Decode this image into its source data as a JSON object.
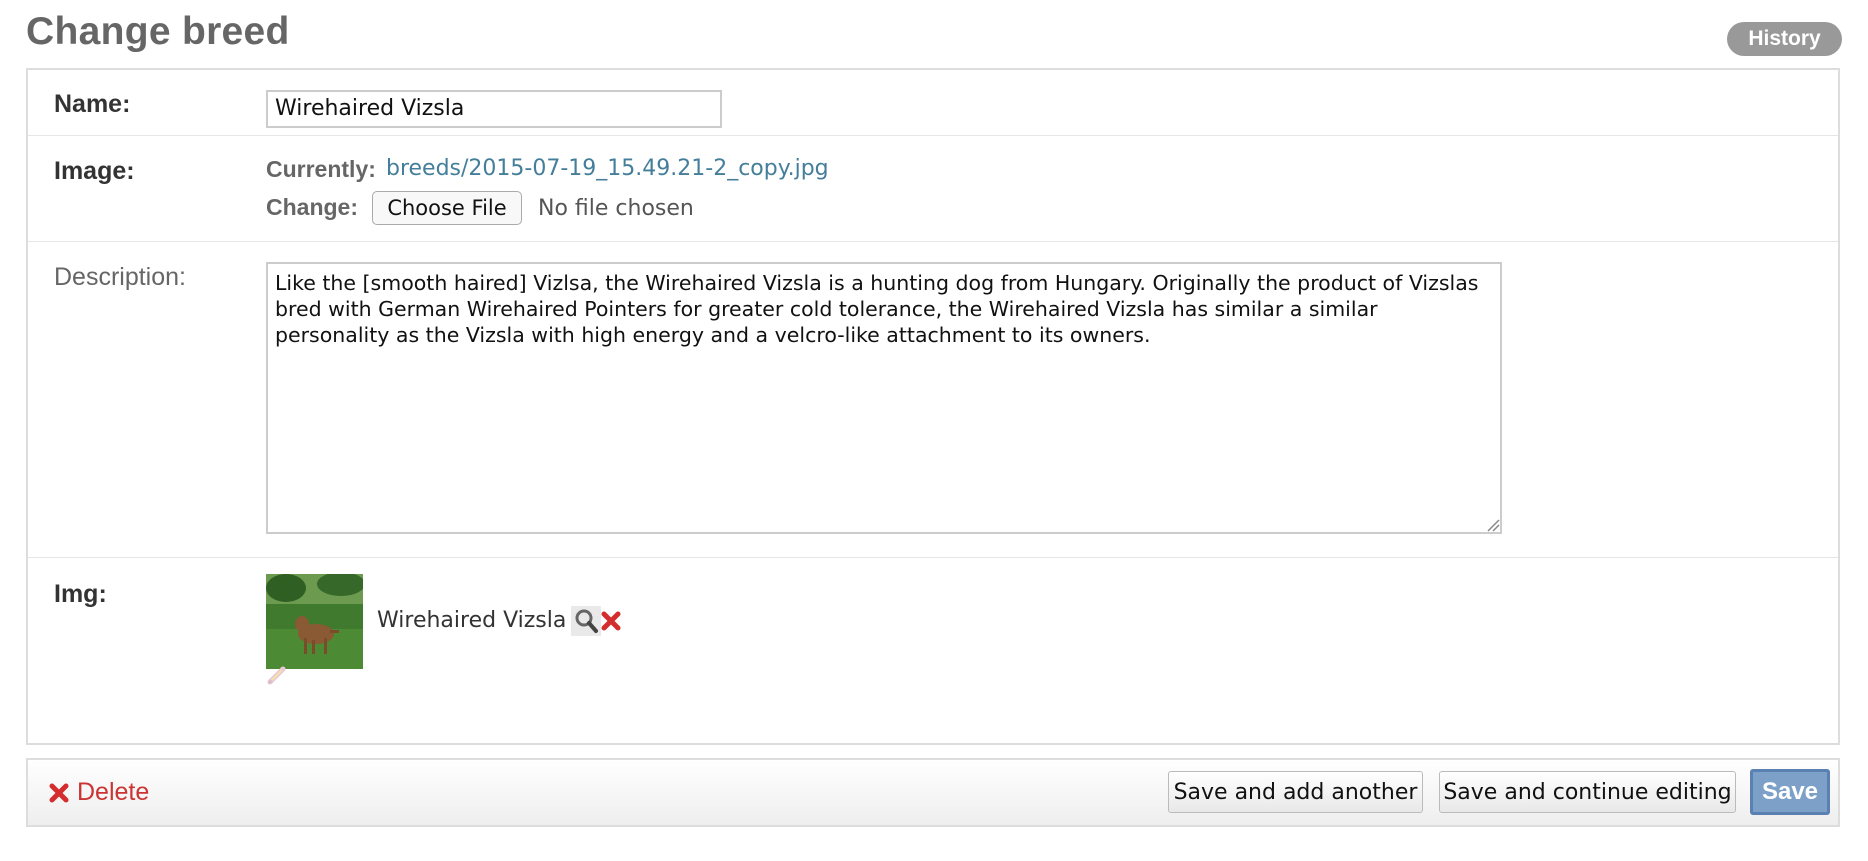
{
  "header": {
    "title": "Change breed",
    "history_label": "History"
  },
  "form": {
    "name": {
      "label": "Name:",
      "value": "Wirehaired Vizsla"
    },
    "image": {
      "label": "Image:",
      "currently_label": "Currently:",
      "current_file": "breeds/2015-07-19_15.49.21-2_copy.jpg",
      "change_label": "Change:",
      "choose_file_label": "Choose File",
      "no_file_text": "No file chosen"
    },
    "description": {
      "label": "Description:",
      "value": "Like the [smooth haired] Vizlsa, the Wirehaired Vizsla is a hunting dog from Hungary. Originally the product of Vizslas bred with German Wirehaired Pointers for greater cold tolerance, the Wirehaired Vizsla has similar a similar personality as the Vizsla with high energy and a velcro-like attachment to its owners."
    },
    "img": {
      "label": "Img:",
      "selected_name": "Wirehaired Vizsla",
      "lookup_icon": "magnifier-icon",
      "remove_icon": "red-x-icon",
      "edit_icon": "pencil-icon"
    }
  },
  "submit_row": {
    "delete_label": "Delete",
    "save_add_label": "Save and add another",
    "save_continue_label": "Save and continue editing",
    "save_label": "Save"
  },
  "colors": {
    "link": "#447e9b",
    "delete": "#cc3434",
    "save_button": "#7ca0c7",
    "history_button": "#999999"
  }
}
